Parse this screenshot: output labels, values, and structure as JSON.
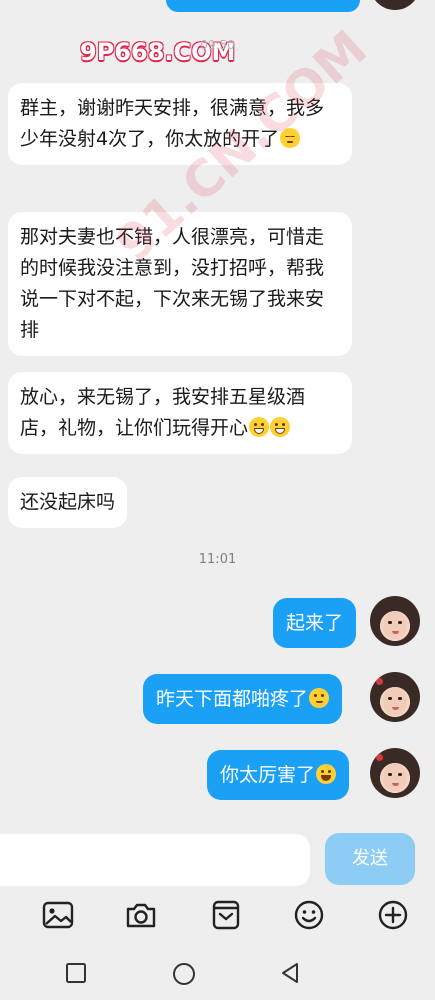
{
  "watermark": {
    "text": "9P668.COM",
    "diagonal": "91.CN.COM"
  },
  "top_timestamp": "09:50",
  "messages": [
    {
      "side": "left",
      "text": "群主，谢谢昨天安排，很满意，我多少年没射4次了，你太放的开了",
      "emoji": "sleepy"
    },
    {
      "side": "left",
      "text": "那对夫妻也不错，人很漂亮，可惜走的时候我没注意到，没打招呼，帮我说一下对不起，下次来无锡了我来安排"
    },
    {
      "side": "left",
      "text": "放心，来无锡了，我安排五星级酒店，礼物，让你们玩得开心",
      "emoji": "grin-grin"
    },
    {
      "side": "left",
      "text": "还没起床吗"
    },
    {
      "side": "right",
      "text": "起来了"
    },
    {
      "side": "right",
      "text": "昨天下面都啪疼了",
      "emoji": "smirk"
    },
    {
      "side": "right",
      "text": "你太厉害了",
      "emoji": "tears-of-joy"
    }
  ],
  "timestamp": "11:01",
  "input": {
    "placeholder": ""
  },
  "send_label": "发送",
  "toolbar_icons": [
    "image-icon",
    "camera-icon",
    "pocket-icon",
    "smiley-icon",
    "plus-icon"
  ],
  "nav_icons": [
    "recents-square-icon",
    "home-circle-icon",
    "back-triangle-icon"
  ],
  "colors": {
    "bubble_right": "#1aa0f5",
    "bubble_left": "#ffffff",
    "background": "#eeeeee",
    "send_disabled": "#8dccf5"
  }
}
